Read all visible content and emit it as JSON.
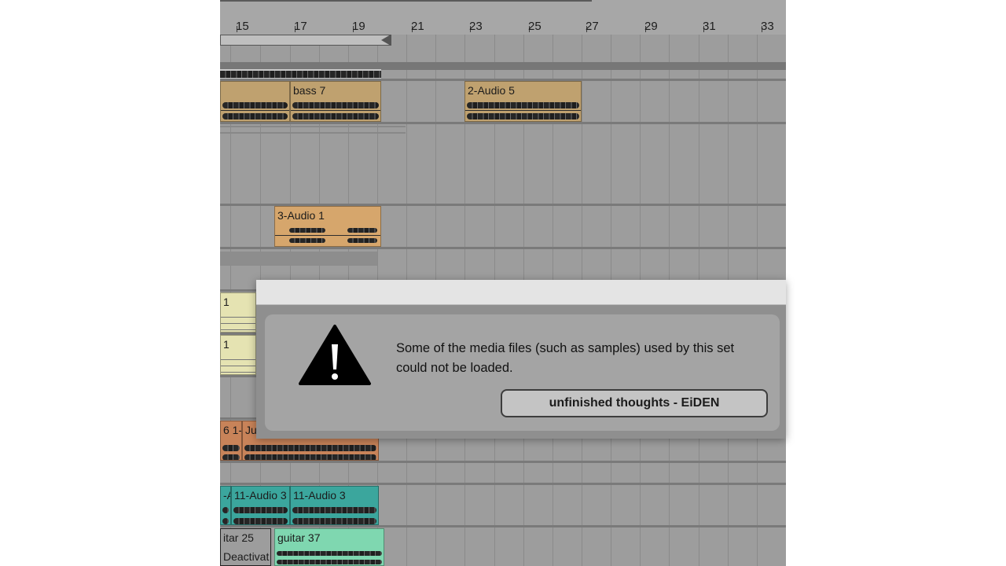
{
  "arrangement": {
    "bar_numbers": [
      "15",
      "17",
      "19",
      "21",
      "23",
      "25",
      "27",
      "29",
      "31",
      "33"
    ],
    "clips": {
      "bass7": "bass 7",
      "audio2_5": "2-Audio 5",
      "audio3_1": "3-Audio 1",
      "clip_a": "1",
      "clip_b": "1",
      "clip_c1": "6 1-",
      "clip_c2": "Ju",
      "clip_d1": "-A",
      "clip_d2": "11-Audio 3",
      "clip_d3": "11-Audio 3",
      "clip_e1": "itar 25",
      "clip_e2": "Deactivat",
      "clip_f": "guitar 37"
    }
  },
  "dialog": {
    "message": "Some of the media files (such as samples) used by this set could not be loaded.",
    "button_label": "unfinished thoughts - EiDEN"
  },
  "colors": {
    "bass": "#bfa16f",
    "audio3": "#d6a66c",
    "yellow": "#e5e3b2",
    "orange": "#c88359",
    "teal": "#3ba69d",
    "green": "#7fd7b0"
  }
}
